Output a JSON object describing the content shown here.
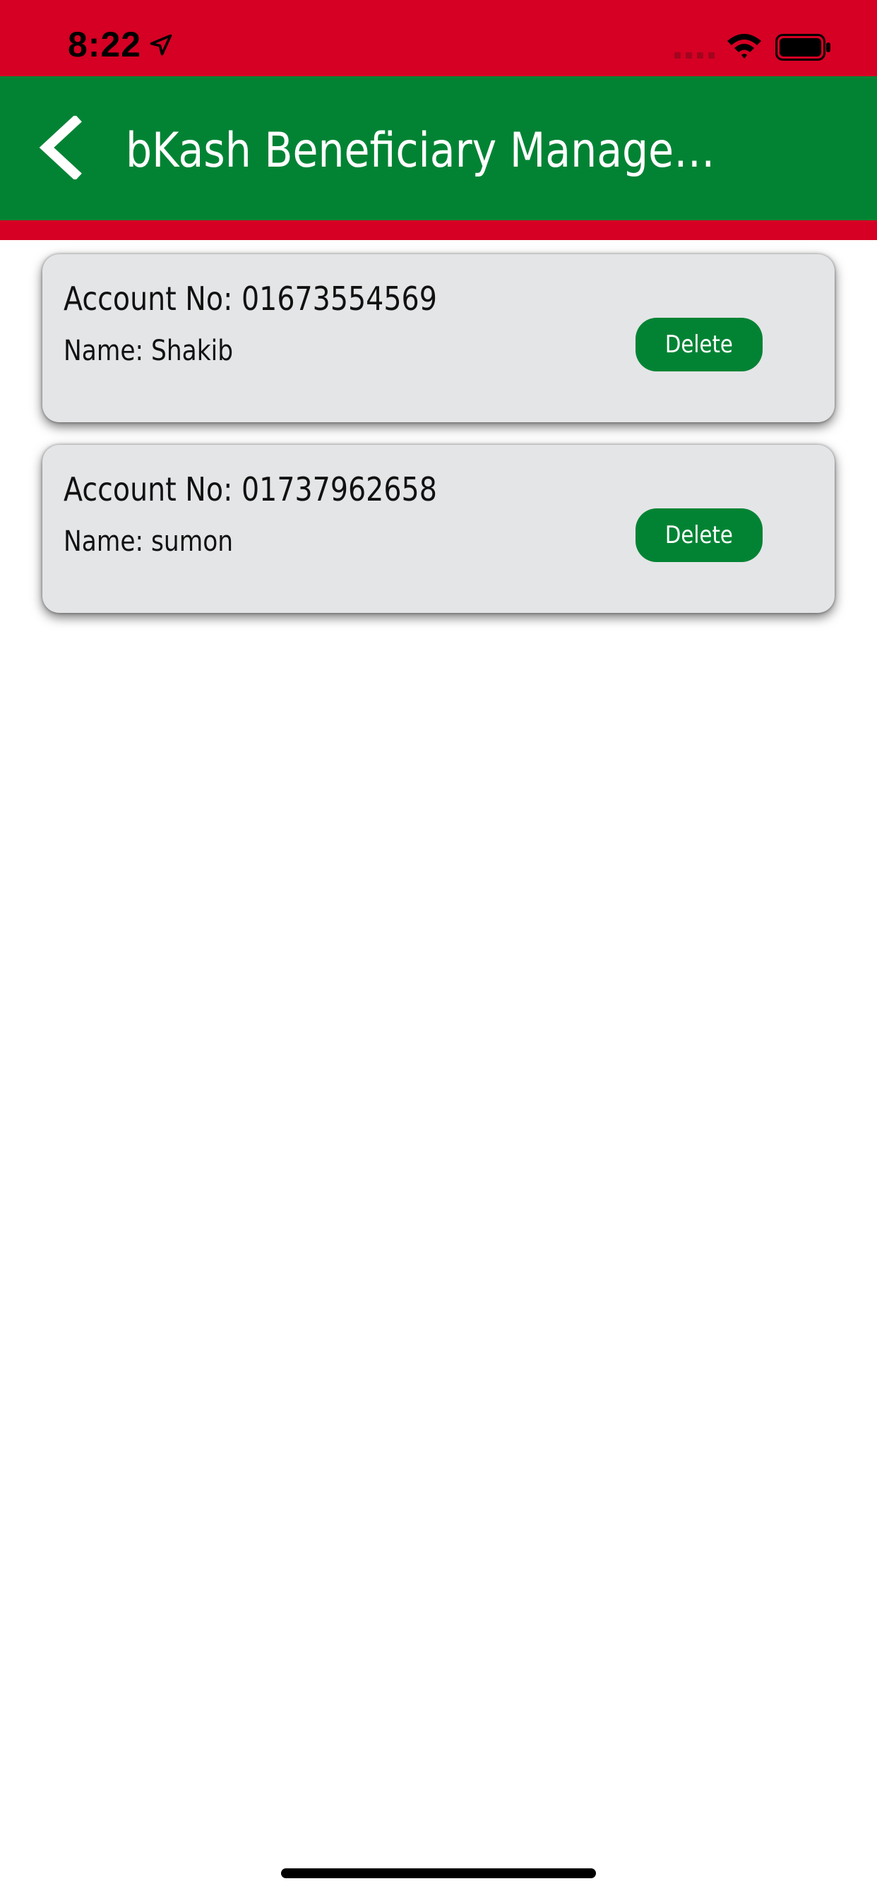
{
  "status_bar": {
    "time": "8:22",
    "icons": [
      "location-arrow-icon",
      "cellular-signal-icon",
      "wifi-icon",
      "battery-icon"
    ]
  },
  "nav": {
    "title": "bKash Beneficiary Managem...",
    "back_icon": "chevron-left-icon"
  },
  "beneficiaries": [
    {
      "account_label": "Account No: 01673554569",
      "name_label": "Name: Shakib",
      "delete_label": "Delete"
    },
    {
      "account_label": "Account No: 01737962658",
      "name_label": "Name: sumon",
      "delete_label": "Delete"
    }
  ],
  "colors": {
    "brand_red": "#d50024",
    "brand_green": "#028334",
    "card_background": "#e4e5e7"
  }
}
